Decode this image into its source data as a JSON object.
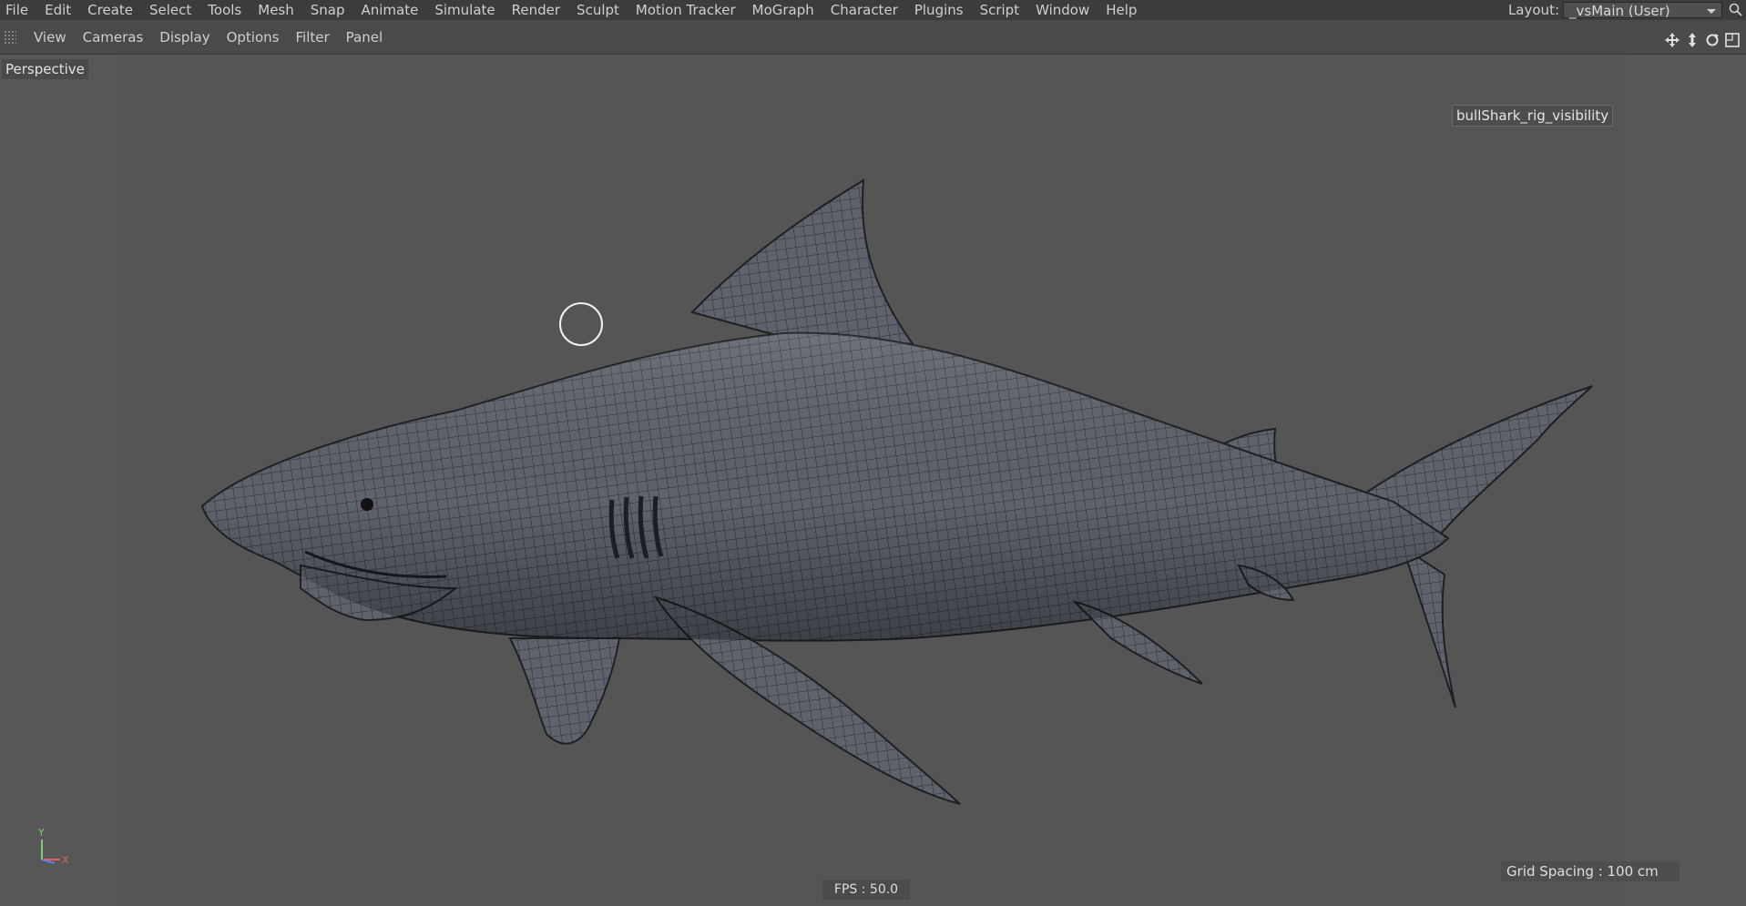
{
  "menubar": {
    "items": [
      "File",
      "Edit",
      "Create",
      "Select",
      "Tools",
      "Mesh",
      "Snap",
      "Animate",
      "Simulate",
      "Render",
      "Sculpt",
      "Motion Tracker",
      "MoGraph",
      "Character",
      "Plugins",
      "Script",
      "Window",
      "Help"
    ],
    "layout_label": "Layout:",
    "layout_value": "_vsMain (User)"
  },
  "toolbar": {
    "items": [
      "View",
      "Cameras",
      "Display",
      "Options",
      "Filter",
      "Panel"
    ]
  },
  "viewport": {
    "camera_label": "Perspective",
    "object_tag": "bullShark_rig_visibility",
    "fps": "FPS : 50.0",
    "grid_spacing": "Grid Spacing : 100 cm",
    "axis_y": "Y",
    "axis_x": "X",
    "background_color": "#555555",
    "mesh_color": "#5f636b"
  },
  "icons": [
    "grip-icon",
    "move-view-icon",
    "zoom-view-icon",
    "rotate-view-icon",
    "maximize-view-icon",
    "search-icon",
    "chevron-down-icon",
    "shark-mesh",
    "cursor-circle",
    "axis-gizmo"
  ]
}
